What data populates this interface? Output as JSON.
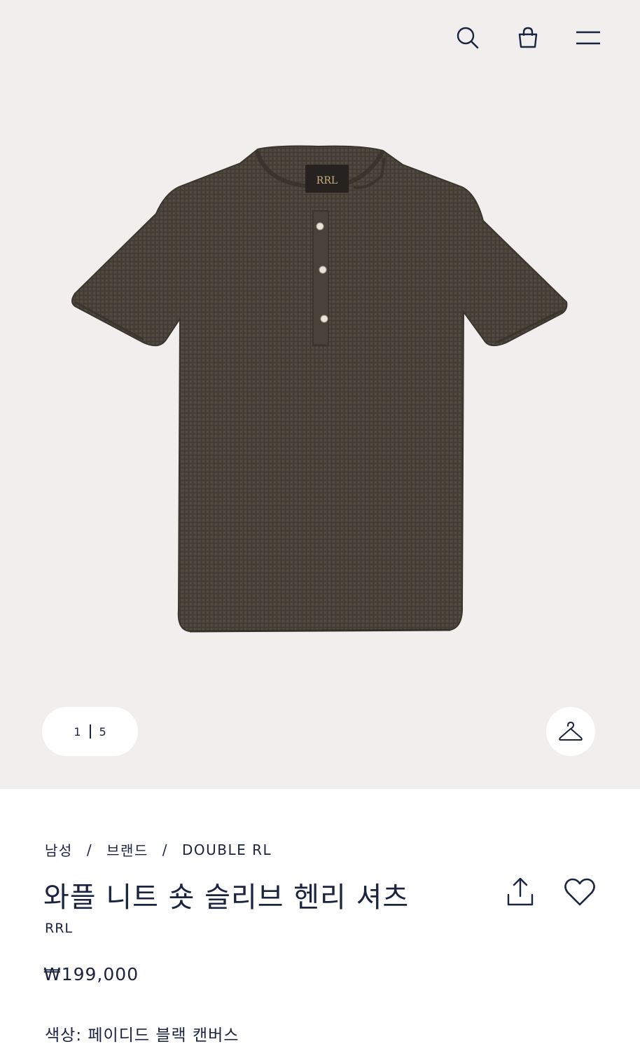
{
  "header": {
    "icons": [
      "search-icon",
      "shopping-bag-icon",
      "menu-icon"
    ]
  },
  "gallery": {
    "current": "1",
    "total": "5"
  },
  "breadcrumb": {
    "items": [
      "남성",
      "브랜드",
      "DOUBLE RL"
    ],
    "separator": "/"
  },
  "product": {
    "title": "와플 니트 숏 슬리브 헨리 셔츠",
    "brand": "RRL",
    "price": "₩199,000",
    "color_label": "색상:",
    "color_value": "페이디드 블랙 캔버스",
    "shirt_color": "#4d463c",
    "label_logo": "RRL"
  },
  "colors": {
    "text": "#1a2340",
    "hero_background": "#f1efee"
  }
}
